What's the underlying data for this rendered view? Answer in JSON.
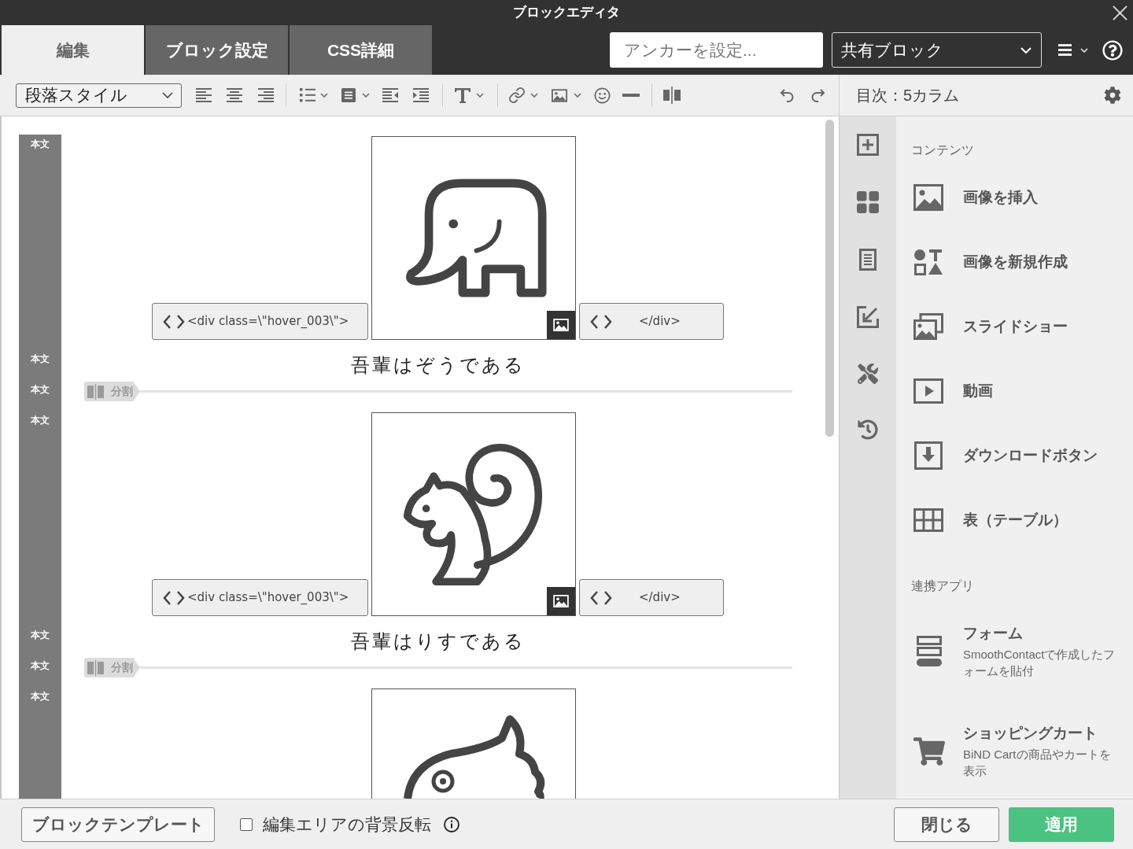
{
  "window": {
    "title": "ブロックエディタ"
  },
  "tabs": [
    {
      "label": "編集",
      "selected": true
    },
    {
      "label": "ブロック設定",
      "selected": false
    },
    {
      "label": "CSS詳細",
      "selected": false
    }
  ],
  "anchor_field": {
    "placeholder": "アンカーを設定..."
  },
  "shared_block_select": {
    "value": "共有ブロック"
  },
  "toolbar": {
    "paragraph_style": "段落スタイル"
  },
  "editor": {
    "rows": [
      {
        "kind": "image",
        "label": "本文",
        "open_tag": "<div class=\\\"hover_003\\\">",
        "close_tag": "</div>"
      },
      {
        "kind": "caption",
        "label": "本文",
        "text": "吾輩はぞうである"
      },
      {
        "kind": "divider",
        "label": "本文",
        "text": "分割"
      },
      {
        "kind": "image",
        "label": "本文",
        "open_tag": "<div class=\\\"hover_003\\\">",
        "close_tag": "</div>"
      },
      {
        "kind": "caption",
        "label": "本文",
        "text": "吾輩はりすである"
      },
      {
        "kind": "divider",
        "label": "本文",
        "text": "分割"
      },
      {
        "kind": "image",
        "label": "本文"
      }
    ]
  },
  "side_panel": {
    "title": "目次：5カラム",
    "sections": [
      {
        "heading": "コンテンツ",
        "items": [
          {
            "label": "画像を挿入"
          },
          {
            "label": "画像を新規作成"
          },
          {
            "label": "スライドショー"
          },
          {
            "label": "動画"
          },
          {
            "label": "ダウンロードボタン"
          },
          {
            "label": "表（テーブル）"
          }
        ]
      },
      {
        "heading": "連携アプリ",
        "items": [
          {
            "label": "フォーム",
            "description": "SmoothContactで作成したフォームを貼付"
          },
          {
            "label": "ショッピングカート",
            "description": "BiND Cartの商品やカートを表示"
          }
        ]
      }
    ]
  },
  "footer": {
    "template_button": "ブロックテンプレート",
    "invert_background": {
      "label": "編集エリアの背景反転",
      "checked": false
    },
    "buttons": [
      {
        "label": "閉じる",
        "kind": "secondary"
      },
      {
        "label": "適用",
        "kind": "primary"
      }
    ]
  }
}
